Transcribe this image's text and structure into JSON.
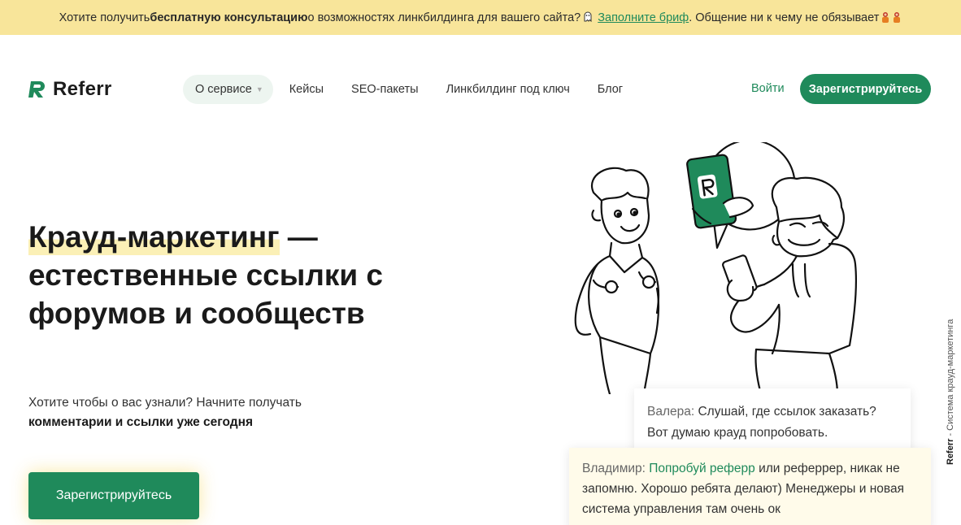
{
  "banner": {
    "text_before": "Хотите получить ",
    "text_bold": "бесплатную консультацию",
    "text_middle": " о возможностях линкбилдинга для вашего сайта?",
    "link_text": "Заполните бриф",
    "text_after": ". Общение ни к чему не обязывает"
  },
  "header": {
    "logo_text": "Referr",
    "nav": [
      {
        "label": "О сервисе"
      },
      {
        "label": "Кейсы"
      },
      {
        "label": "SEO-пакеты"
      },
      {
        "label": "Линкбилдинг под ключ"
      },
      {
        "label": "Блог"
      }
    ],
    "login_label": "Войти",
    "signup_label": "Зарегистрируйтесь"
  },
  "hero": {
    "title_highlight": "Крауд-маркетинг",
    "title_rest1": " —",
    "title_line2": "естественные ссылки с",
    "title_line3": "форумов и сообществ",
    "sub_line1": "Хотите чтобы о вас узнали? Начните получать",
    "sub_bold": "комментарии и ссылки уже сегодня",
    "button_label": "Зарегистрируйтесь"
  },
  "chat": {
    "msg1_name": "Валера:",
    "msg1_text": " Слушай, где ссылок заказать? Вот думаю крауд попробовать.",
    "msg2_name": "Владимир:",
    "msg2_link": "Попробуй реферр",
    "msg2_text": " или реферрер, никак не запомню. Хорошо ребята делают) Менеджеры и новая система управления там очень ок"
  },
  "side": {
    "brand": "Referr",
    "text": " - Система крауд-маркетинга"
  },
  "colors": {
    "brand_green": "#1f8a5b",
    "banner_bg": "#f8e59a",
    "highlight": "#fbf0b6"
  }
}
